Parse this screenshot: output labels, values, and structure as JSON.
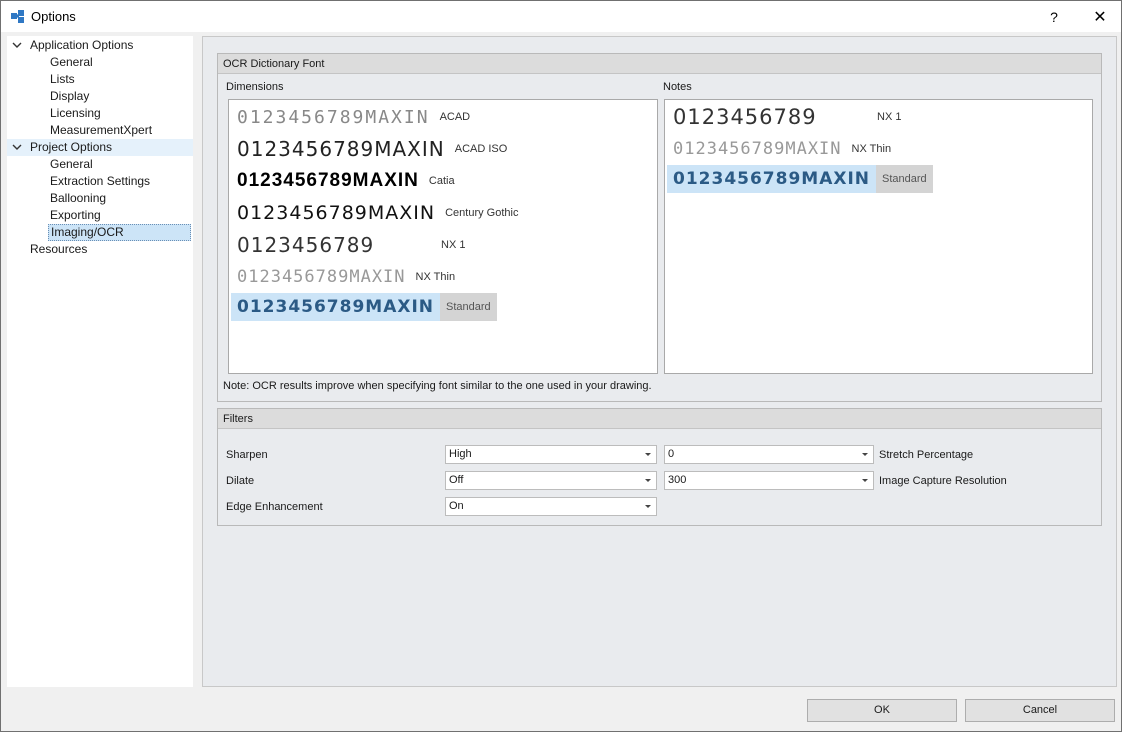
{
  "window": {
    "title": "Options",
    "help_glyph": "?",
    "close_glyph": "✕"
  },
  "tree": {
    "application_options": "Application Options",
    "app_children": [
      "General",
      "Lists",
      "Display",
      "Licensing",
      "MeasurementXpert"
    ],
    "project_options": "Project Options",
    "project_children": [
      "General",
      "Extraction Settings",
      "Ballooning",
      "Exporting",
      "Imaging/OCR"
    ],
    "resources": "Resources"
  },
  "ocr_group": {
    "header": "OCR Dictionary Font",
    "dimensions_label": "Dimensions",
    "notes_label": "Notes",
    "dimensions_fonts": [
      {
        "sample": "0123456789MAXIN",
        "name": "ACAD"
      },
      {
        "sample": "0123456789MAXIN",
        "name": "ACAD ISO"
      },
      {
        "sample": "0123456789MAXIN",
        "name": "Catia"
      },
      {
        "sample": "0123456789MAXIN",
        "name": "Century Gothic"
      },
      {
        "sample": "0123456789",
        "name": "NX 1"
      },
      {
        "sample": "0123456789MAXIN",
        "name": "NX Thin"
      },
      {
        "sample": "0123456789MAXIN",
        "name": "Standard"
      }
    ],
    "notes_fonts": [
      {
        "sample": "0123456789",
        "name": "NX 1"
      },
      {
        "sample": "0123456789MAXIN",
        "name": "NX Thin"
      },
      {
        "sample": "0123456789MAXIN",
        "name": "Standard"
      }
    ],
    "note": "Note: OCR results improve when specifying font similar to the one used in your drawing."
  },
  "filters_group": {
    "header": "Filters",
    "sharpen_label": "Sharpen",
    "sharpen_value": "High",
    "dilate_label": "Dilate",
    "dilate_value": "Off",
    "edge_label": "Edge Enhancement",
    "edge_value": "On",
    "stretch_value": "0",
    "stretch_label": "Stretch Percentage",
    "resolution_value": "300",
    "resolution_label": "Image Capture Resolution"
  },
  "buttons": {
    "ok": "OK",
    "cancel": "Cancel"
  },
  "colors": {
    "selection": "#cce4f7",
    "selection_text": "#2b5a85",
    "panel": "#e9ebee"
  }
}
